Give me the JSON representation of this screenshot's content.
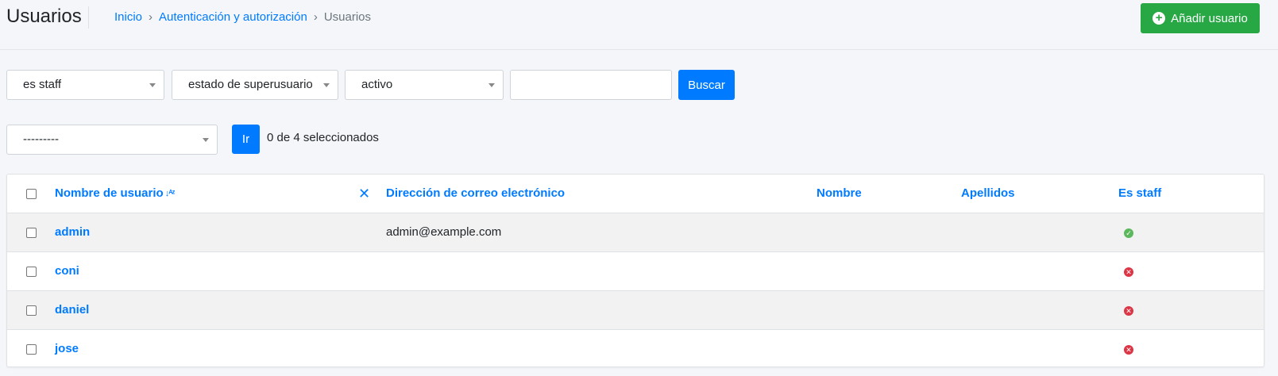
{
  "header": {
    "title": "Usuarios",
    "breadcrumb": [
      "Inicio",
      "Autenticación y autorización",
      "Usuarios"
    ],
    "add_button_label": "Añadir usuario"
  },
  "filters": {
    "staff_select": "es staff",
    "superuser_select": "estado de superusuario",
    "active_select": "activo",
    "search_value": "",
    "search_button": "Buscar"
  },
  "actions": {
    "action_select": "---------",
    "go_button": "Ir",
    "selected_count": "0 de 4 seleccionados"
  },
  "table": {
    "columns": [
      "Nombre de usuario",
      "Dirección de correo electrónico",
      "Nombre",
      "Apellidos",
      "Es staff"
    ],
    "sort_icon": "sort-alpha-down-icon",
    "remove_sort_icon": "✕",
    "rows": [
      {
        "username": "admin",
        "email": "admin@example.com",
        "first_name": "",
        "last_name": "",
        "is_staff": true
      },
      {
        "username": "coni",
        "email": "",
        "first_name": "",
        "last_name": "",
        "is_staff": false
      },
      {
        "username": "daniel",
        "email": "",
        "first_name": "",
        "last_name": "",
        "is_staff": false
      },
      {
        "username": "jose",
        "email": "",
        "first_name": "",
        "last_name": "",
        "is_staff": false
      }
    ]
  },
  "colors": {
    "primary": "#007bff",
    "success": "#28a745",
    "danger": "#dc3545",
    "background": "#f4f6f9"
  }
}
